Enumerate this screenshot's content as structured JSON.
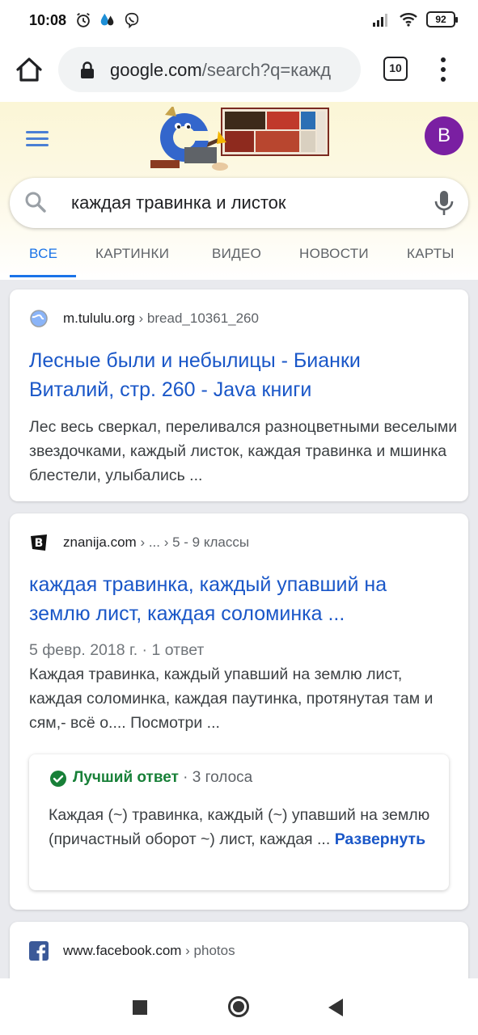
{
  "status_bar": {
    "time": "10:08",
    "battery": "92"
  },
  "browser": {
    "url_domain": "google.com",
    "url_rest": "/search?q=кажд",
    "tab_count": "10"
  },
  "google": {
    "avatar_letter": "B",
    "query": "каждая травинка и листок",
    "tabs": [
      {
        "label": "ВСЕ",
        "active": true
      },
      {
        "label": "КАРТИНКИ"
      },
      {
        "label": "ВИДЕО"
      },
      {
        "label": "НОВОСТИ"
      },
      {
        "label": "КАРТЫ"
      }
    ]
  },
  "results": [
    {
      "domain": "m.tululu.org",
      "crumb": " › bread_10361_260",
      "title": "Лесные были и небылицы - Бианки Виталий, стр. 260 - Java книги",
      "snippet": "Лес весь сверкал, переливался разноцветными веселыми звездочками, каждый листок, каждая травинка и мшинка блестели, улыбались ..."
    },
    {
      "domain": "znanija.com",
      "crumb": " › ... › 5 - 9 классы",
      "title": "каждая травинка, каждый упавший на землю лист, каждая соломинка ...",
      "date": "5 февр. 2018 г. · 1 ответ",
      "snippet": "Каждая травинка, каждый упавший на землю лист, каждая соломинка, каждая паутинка, протянутая там и сям,- всё о.... Посмотри ...",
      "answer": {
        "label": "Лучший ответ",
        "votes": " · 3 голоса",
        "text": "Каждая (~) травинка, каждый (~) упавший на землю (причастный оборот ~) лист, каждая ... ",
        "expand": "Развернуть"
      }
    },
    {
      "domain": "www.facebook.com",
      "crumb": " › photos"
    }
  ]
}
